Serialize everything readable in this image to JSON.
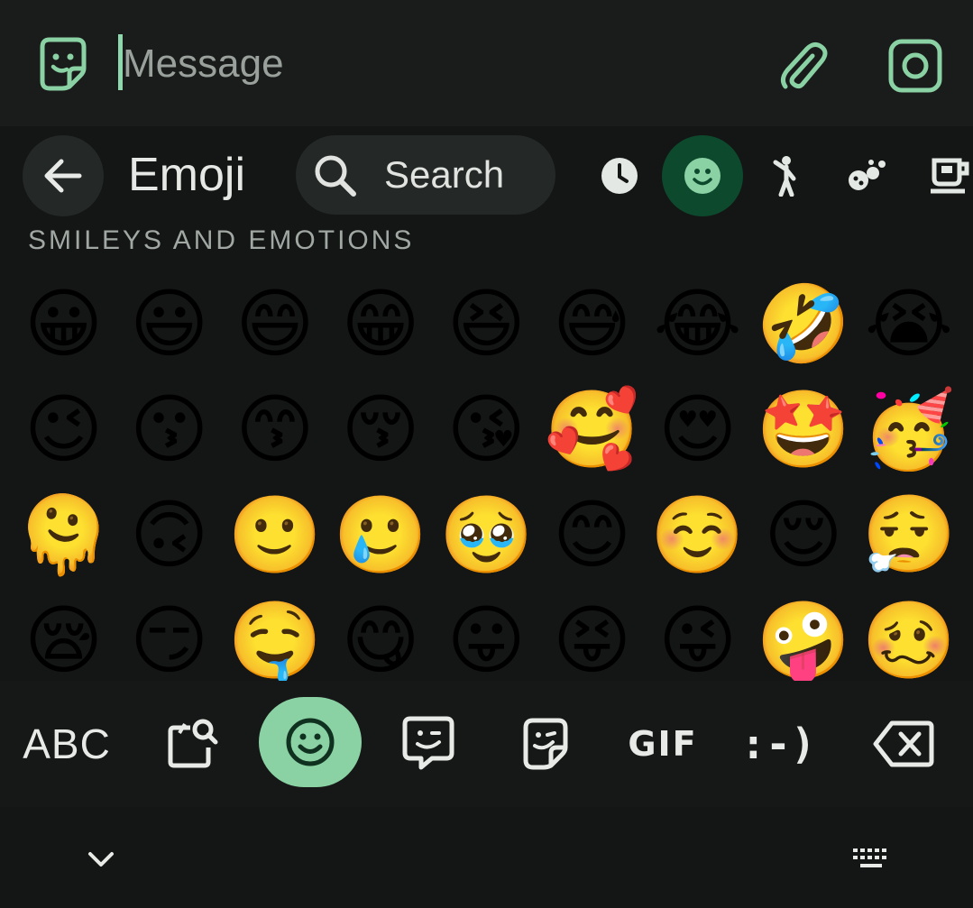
{
  "compose": {
    "sticker_button": "sticker-icon",
    "placeholder": "Message",
    "value": "",
    "attach_button": "paperclip-icon",
    "camera_button": "camera-icon"
  },
  "keyboard": {
    "back_icon": "arrow-left-icon",
    "title": "Emoji",
    "search_label": "Search",
    "categories": [
      {
        "name": "recent",
        "icon": "clock-icon",
        "selected": false
      },
      {
        "name": "smileys",
        "icon": "smiley-icon",
        "selected": true
      },
      {
        "name": "people",
        "icon": "person-icon",
        "selected": false
      },
      {
        "name": "animals",
        "icon": "animal-icon",
        "selected": false
      },
      {
        "name": "food",
        "icon": "cup-icon",
        "selected": false
      }
    ],
    "section_title": "SMILEYS AND EMOTIONS",
    "emojis": [
      "😀",
      "😃",
      "😄",
      "😁",
      "😆",
      "😅",
      "😂",
      "🤣",
      "😭",
      "😉",
      "😗",
      "😙",
      "😚",
      "😘",
      "🥰",
      "😍",
      "🤩",
      "🥳",
      "🫠",
      "🙃",
      "🙂",
      "🥲",
      "🥹",
      "😊",
      "☺️",
      "😌",
      "😮‍💨",
      "😪",
      "😏",
      "🤤",
      "😋",
      "😛",
      "😝",
      "😜",
      "🤪",
      "🥴"
    ],
    "bottom": {
      "abc_label": "ABC",
      "clipboard": "clipboard-search-icon",
      "emoji": "smiley-icon",
      "bitmoji": "speech-face-icon",
      "sticker": "sticker-icon",
      "gif_label": "GIF",
      "emoticon_label": ":-)",
      "backspace": "backspace-icon"
    },
    "nav": {
      "hide": "chevron-down-icon",
      "switch": "keyboard-icon"
    }
  },
  "colors": {
    "accent": "#8ad1a4",
    "selected_category_bg": "#0d4a2d",
    "background": "#141615"
  }
}
